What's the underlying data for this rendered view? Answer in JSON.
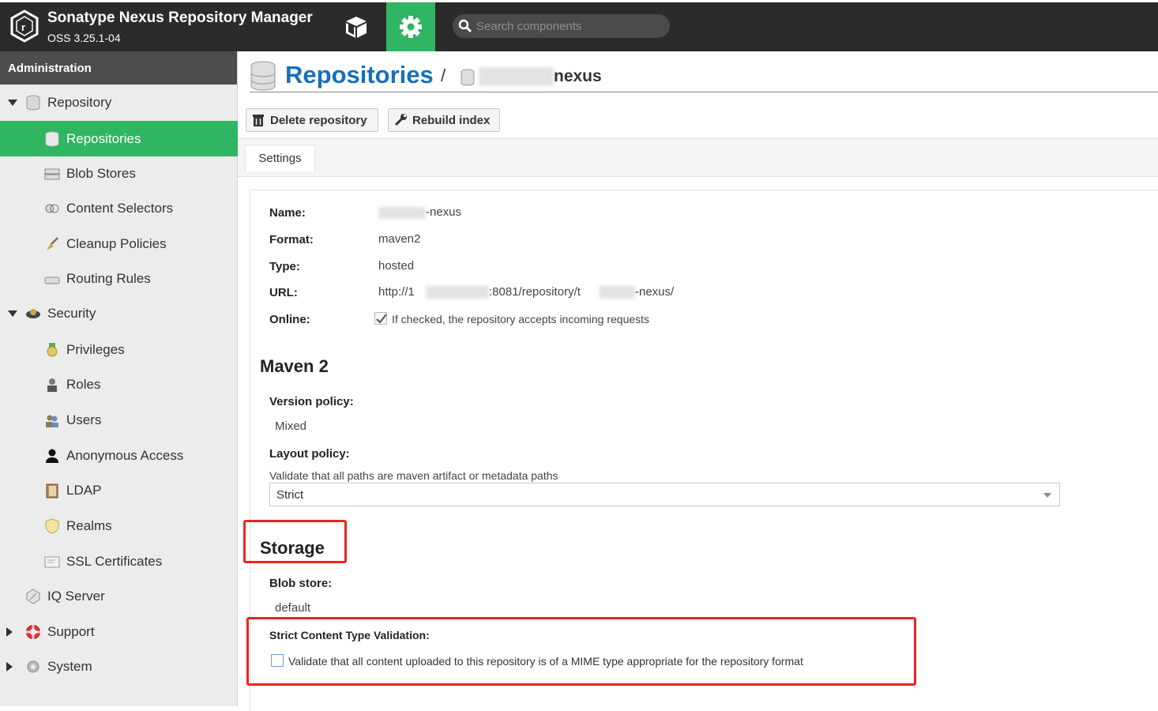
{
  "app": {
    "title": "Sonatype Nexus Repository Manager",
    "version": "OSS 3.25.1-04"
  },
  "search": {
    "placeholder": "Search components"
  },
  "sidebar": {
    "header": "Administration",
    "items": [
      {
        "label": "Repository",
        "icon": "database-icon",
        "level": 0,
        "expanded": true
      },
      {
        "label": "Repositories",
        "icon": "database-icon",
        "level": 1,
        "active": true
      },
      {
        "label": "Blob Stores",
        "icon": "server-icon",
        "level": 1
      },
      {
        "label": "Content Selectors",
        "icon": "selector-icon",
        "level": 1
      },
      {
        "label": "Cleanup Policies",
        "icon": "broom-icon",
        "level": 1
      },
      {
        "label": "Routing Rules",
        "icon": "router-icon",
        "level": 1
      },
      {
        "label": "Security",
        "icon": "security-badge-icon",
        "level": 0,
        "expanded": true
      },
      {
        "label": "Privileges",
        "icon": "medal-icon",
        "level": 1
      },
      {
        "label": "Roles",
        "icon": "role-icon",
        "level": 1
      },
      {
        "label": "Users",
        "icon": "users-icon",
        "level": 1
      },
      {
        "label": "Anonymous Access",
        "icon": "person-icon",
        "level": 1
      },
      {
        "label": "LDAP",
        "icon": "book-icon",
        "level": 1
      },
      {
        "label": "Realms",
        "icon": "shield-icon",
        "level": 1
      },
      {
        "label": "SSL Certificates",
        "icon": "certificate-icon",
        "level": 1
      },
      {
        "label": "IQ Server",
        "icon": "iq-icon",
        "level": 0
      },
      {
        "label": "Support",
        "icon": "lifebuoy-icon",
        "level": 0,
        "collapsed": true
      },
      {
        "label": "System",
        "icon": "gear-icon",
        "level": 0,
        "collapsed": true
      }
    ]
  },
  "breadcrumb": {
    "title": "Repositories",
    "separator": "/",
    "repo_name": "nexus"
  },
  "toolbar": {
    "delete_label": "Delete repository",
    "rebuild_label": "Rebuild index"
  },
  "tabs": [
    {
      "label": "Settings"
    }
  ],
  "settings": {
    "name_label": "Name:",
    "name_value": "-nexus",
    "format_label": "Format:",
    "format_value": "maven2",
    "type_label": "Type:",
    "type_value": "hosted",
    "url_label": "URL:",
    "url_prefix": "http://1",
    "url_middle": ":8081/repository/t",
    "url_suffix": "-nexus/",
    "online_label": "Online:",
    "online_text": "If checked, the repository accepts incoming requests",
    "online_checked": true
  },
  "maven": {
    "heading": "Maven 2",
    "version_policy_label": "Version policy:",
    "version_policy_value": "Mixed",
    "layout_policy_label": "Layout policy:",
    "layout_policy_help": "Validate that all paths are maven artifact or metadata paths",
    "layout_policy_value": "Strict"
  },
  "storage": {
    "heading": "Storage",
    "blob_store_label": "Blob store:",
    "blob_store_value": "default",
    "strict_label": "Strict Content Type Validation:",
    "strict_text": "Validate that all content uploaded to this repository is of a MIME type appropriate for the repository format",
    "strict_checked": false
  },
  "colors": {
    "brand_green": "#30b562",
    "link_blue": "#1670b8",
    "highlight_red": "#ee2222",
    "topbar": "#2b2b2b"
  }
}
